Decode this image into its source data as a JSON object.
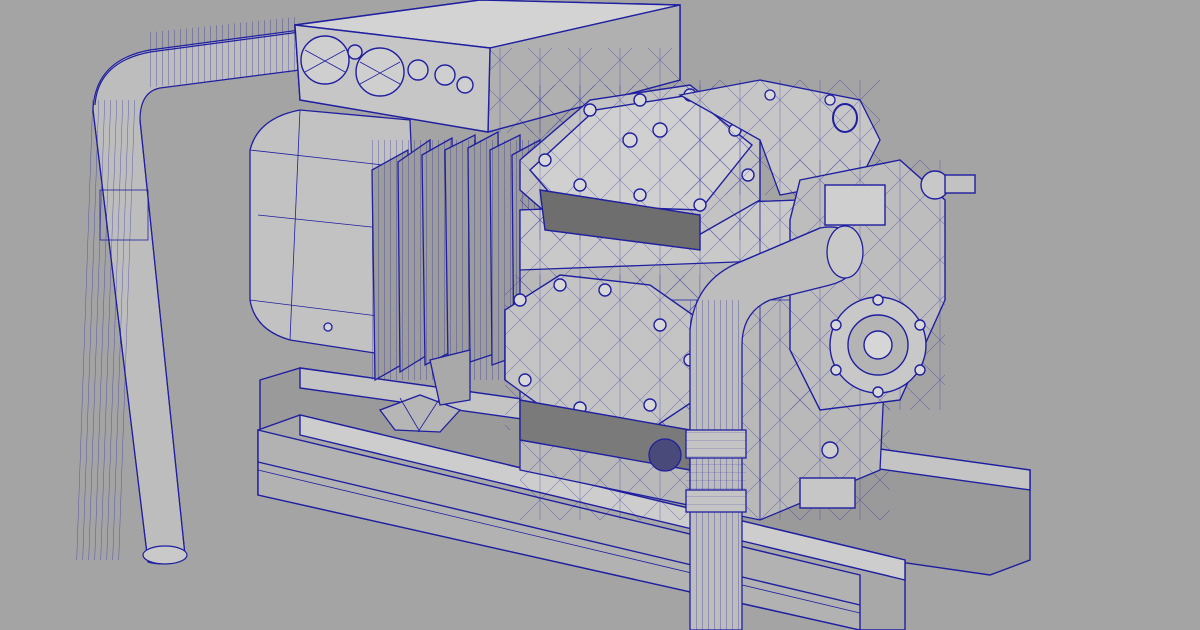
{
  "scene": {
    "subject": "wireframe-3d-render-semi-hermetic-compressor",
    "colors": {
      "background": "#a4a4a4",
      "surface": "#b9b9b9",
      "surface_light": "#cfcfcf",
      "surface_dark": "#8c8c8c",
      "wire": "#1f1fa0",
      "wire_faint": "#3a3ab0"
    }
  }
}
